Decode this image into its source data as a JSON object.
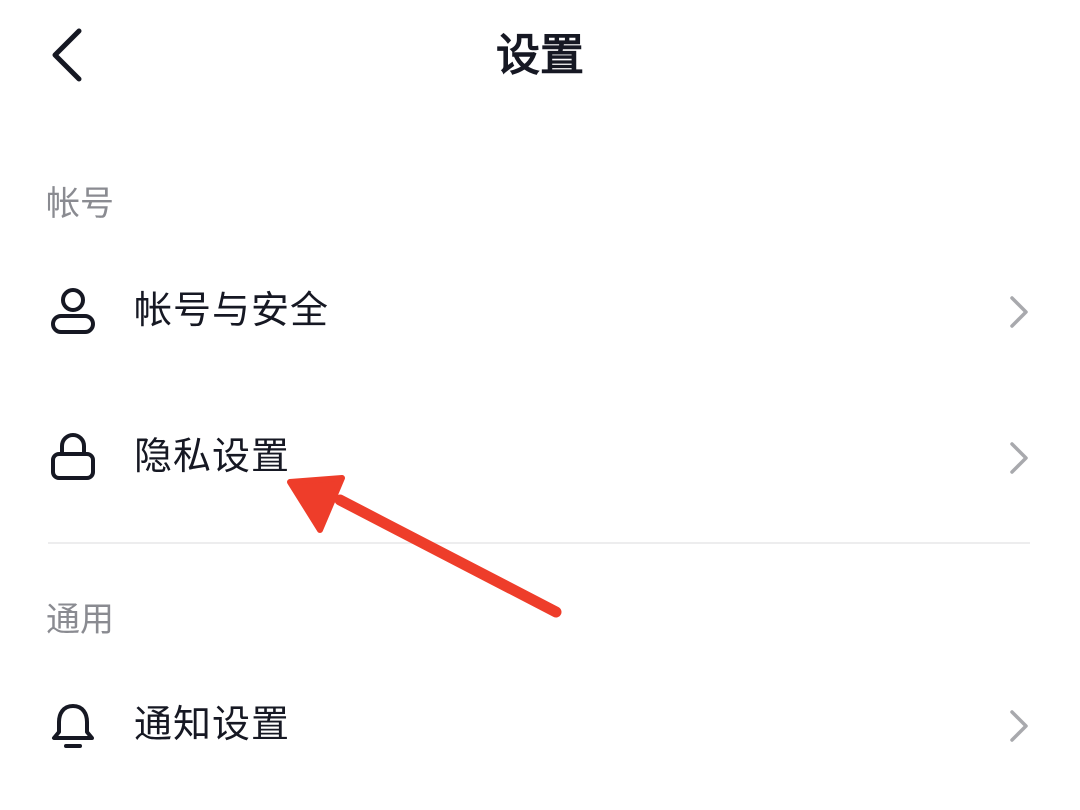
{
  "header": {
    "title": "设置",
    "back_icon": "chevron-left-icon"
  },
  "sections": {
    "account": {
      "title": "帐号",
      "items": [
        {
          "label": "帐号与安全",
          "icon": "user-icon"
        },
        {
          "label": "隐私设置",
          "icon": "lock-icon"
        }
      ]
    },
    "general": {
      "title": "通用",
      "items": [
        {
          "label": "通知设置",
          "icon": "bell-icon"
        }
      ]
    }
  },
  "colors": {
    "text_primary": "#161823",
    "text_secondary": "#8a8b91",
    "chevron": "#a8a9ad",
    "divider": "#ededee",
    "annotation_arrow": "#ee3d2a"
  }
}
